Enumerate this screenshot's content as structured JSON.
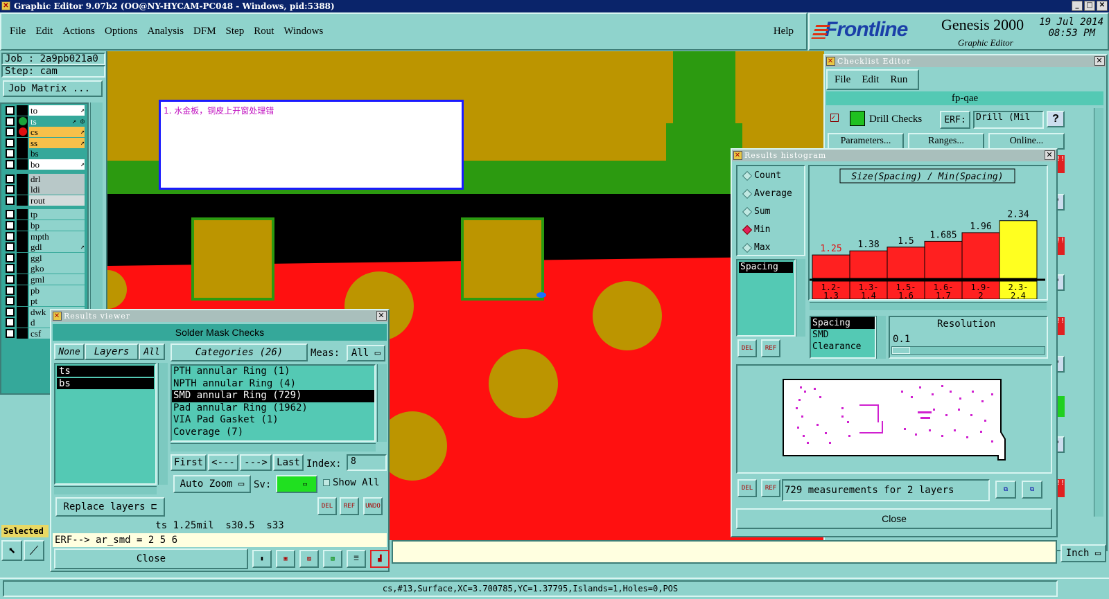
{
  "window": {
    "title": "Graphic Editor 9.07b2 (OO@NY-HYCAM-PC048 - Windows, pid:5388)"
  },
  "menu": {
    "items": [
      "File",
      "Edit",
      "Actions",
      "Options",
      "Analysis",
      "DFM",
      "Step",
      "Rout",
      "Windows"
    ],
    "help": "Help"
  },
  "brand": {
    "logo": "Frontline",
    "product": "Genesis 2000",
    "subtitle": "Graphic Editor",
    "date": "19 Jul 2014",
    "time": "08:53 PM"
  },
  "job": {
    "job_label": "Job : 2a9pb021a0",
    "step_label": "Step: cam",
    "matrix_button": "Job Matrix ..."
  },
  "layers": [
    {
      "name": "to",
      "bg": "#ffffff",
      "dot": "",
      "mark": "↗"
    },
    {
      "name": "ts",
      "bg": "#35a89a",
      "dot": "#1aa33a",
      "mark": "↗ ◎",
      "sel": true
    },
    {
      "name": "cs",
      "bg": "#f7c04a",
      "dot": "#e01010",
      "mark": "↗"
    },
    {
      "name": "ss",
      "bg": "#f7c04a",
      "dot": "",
      "mark": "↗"
    },
    {
      "name": "bs",
      "bg": "#35a89a",
      "dot": "",
      "mark": ""
    },
    {
      "name": "bo",
      "bg": "#ffffff",
      "dot": "",
      "mark": "↗"
    },
    {
      "name": "drl",
      "bg": "#b8c8c8",
      "dot": "",
      "mark": ""
    },
    {
      "name": "ldi",
      "bg": "#b8c8c8",
      "dot": "",
      "mark": ""
    },
    {
      "name": "rout",
      "bg": "#d4dcdc",
      "dot": "",
      "mark": ""
    },
    {
      "name": "tp",
      "bg": "#8fd3cc",
      "dot": "",
      "mark": ""
    },
    {
      "name": "bp",
      "bg": "#8fd3cc",
      "dot": "",
      "mark": ""
    },
    {
      "name": "mpth",
      "bg": "#8fd3cc",
      "dot": "",
      "mark": ""
    },
    {
      "name": "gdl",
      "bg": "#8fd3cc",
      "dot": "",
      "mark": "↗"
    },
    {
      "name": "ggl",
      "bg": "#8fd3cc",
      "dot": "",
      "mark": ""
    },
    {
      "name": "gko",
      "bg": "#8fd3cc",
      "dot": "",
      "mark": ""
    },
    {
      "name": "gml",
      "bg": "#8fd3cc",
      "dot": "",
      "mark": ""
    },
    {
      "name": "pb",
      "bg": "#8fd3cc",
      "dot": "",
      "mark": ""
    },
    {
      "name": "pt",
      "bg": "#8fd3cc",
      "dot": "",
      "mark": ""
    },
    {
      "name": "dwk",
      "bg": "#8fd3cc",
      "dot": "",
      "mark": ""
    },
    {
      "name": "d",
      "bg": "#8fd3cc",
      "dot": "",
      "mark": ""
    },
    {
      "name": "csf",
      "bg": "#8fd3cc",
      "dot": "",
      "mark": ""
    }
  ],
  "selected_label": "Selected",
  "canvas": {
    "note": "1. 水金板，铜皮上开窗处理错"
  },
  "results_viewer": {
    "title": "Results viewer",
    "header": "Solder Mask Checks",
    "none": "None",
    "layers": "Layers",
    "all": "All",
    "categories": "Categories (26)",
    "meas_label": "Meas:",
    "meas_value": "All",
    "layer_list": [
      "ts",
      "bs"
    ],
    "category_list": [
      "PTH annular Ring (1)",
      "NPTH annular Ring (4)",
      "SMD annular Ring (729)",
      "Pad annular Ring (1962)",
      "VIA Pad Gasket (1)",
      "Coverage (7)"
    ],
    "nav": {
      "first": "First",
      "prev": "<---",
      "next": "--->",
      "last": "Last",
      "index_label": "Index:",
      "index_value": "8"
    },
    "auto_zoom": "Auto Zoom",
    "sv": "Sv:",
    "show_all": "Show All",
    "replace_layers": "Replace layers",
    "info": "ts 1.25mil  s30.5  s33",
    "erf": "ERF--> ar_smd = 2 5 6",
    "close": "Close",
    "del": "DEL",
    "ref": "REF",
    "undo": "UNDO"
  },
  "checklist": {
    "title": "Checklist Editor",
    "menu": [
      "File",
      "Edit",
      "Run"
    ],
    "name": "fp-qae",
    "drill": "Drill Checks",
    "erf": "ERF:",
    "erf_value": "Drill (Mil",
    "params": "Parameters...",
    "ranges": "Ranges...",
    "online": "Online..."
  },
  "histogram": {
    "title": "Results histogram",
    "modes": [
      "Count",
      "Average",
      "Sum",
      "Min",
      "Max"
    ],
    "mode_selected": "Min",
    "list1": [
      "Spacing"
    ],
    "list2": [
      "Spacing",
      "SMD",
      "Clearance"
    ],
    "resolution_label": "Resolution",
    "resolution_value": "0.1",
    "summary": "729 measurements for 2 layers",
    "close": "Close",
    "del": "DEL",
    "ref": "REF"
  },
  "chart_data": {
    "type": "bar",
    "title": "Size(Spacing) / Min(Spacing)",
    "categories": [
      "1.2-1.3",
      "1.3-1.4",
      "1.5-1.6",
      "1.6-1.7",
      "1.9-2",
      "2.3-2.4"
    ],
    "values": [
      1.25,
      1.38,
      1.5,
      1.685,
      1.96,
      2.34
    ],
    "value_labels": [
      "1.25",
      "1.38",
      "1.5",
      "1.685",
      "1.96",
      "2.34"
    ],
    "colors": [
      "#ff2020",
      "#ff2020",
      "#ff2020",
      "#ff2020",
      "#ff2020",
      "#ffff20"
    ],
    "ylim": [
      0.9,
      2.4
    ]
  },
  "bottom": {
    "unit": "Inch",
    "status": "cs,#13,Surface,XC=3.700785,YC=1.37795,Islands=1,Holes=0,POS"
  },
  "colors": {
    "titlebar": "#0a246a",
    "panel": "#8fd3cc",
    "copper": "#bc9500",
    "mask": "#ff1010",
    "green": "#2c9a10"
  }
}
